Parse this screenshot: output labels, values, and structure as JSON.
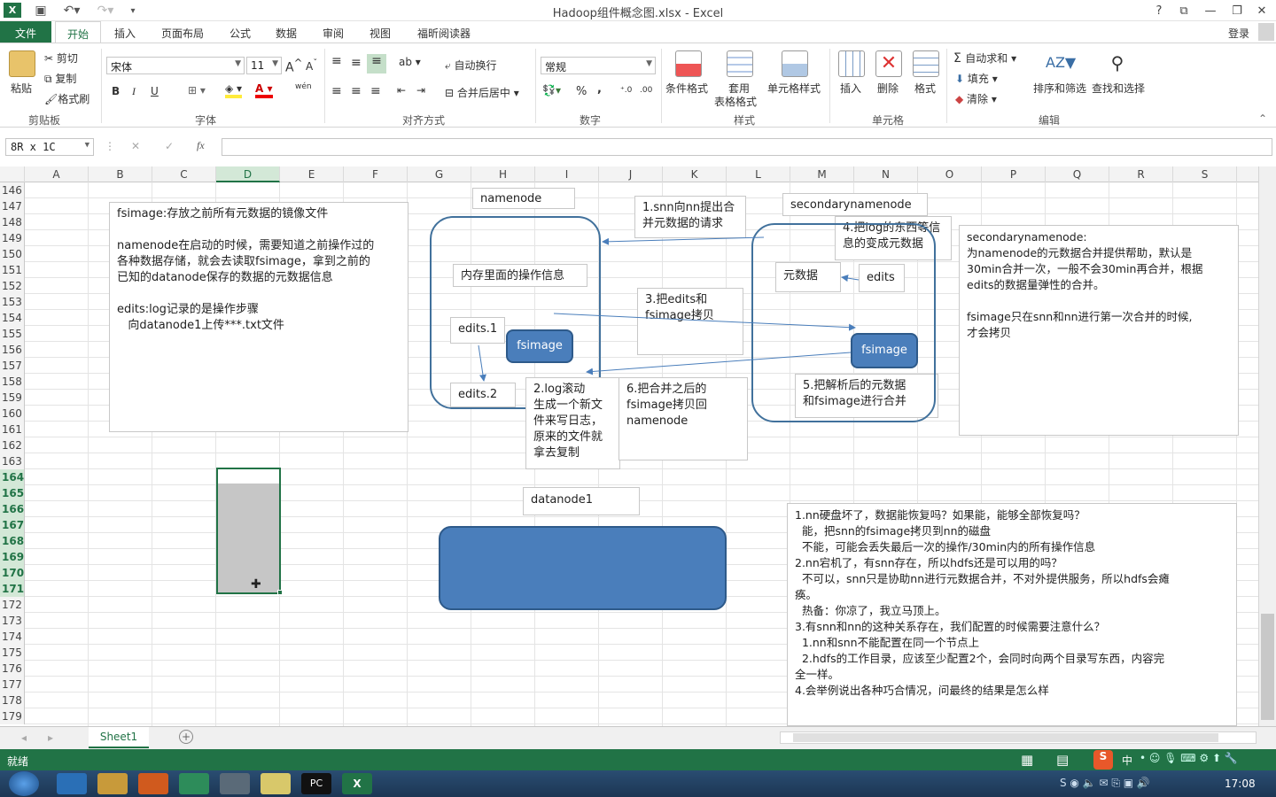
{
  "window": {
    "title": "Hadoop组件概念图.xlsx - Excel",
    "help": "?",
    "signin": "登录"
  },
  "tabs": [
    "文件",
    "开始",
    "插入",
    "页面布局",
    "公式",
    "数据",
    "审阅",
    "视图",
    "福昕阅读器"
  ],
  "ribbon": {
    "clipboard": {
      "paste": "粘贴",
      "cut": "剪切",
      "copy": "复制",
      "painter": "格式刷",
      "label": "剪贴板"
    },
    "font": {
      "name": "宋体",
      "size": "11",
      "bold": "B",
      "italic": "I",
      "underline": "U",
      "label": "字体",
      "wen": "wén"
    },
    "align": {
      "wrap": "自动换行",
      "merge": "合并后居中",
      "label": "对齐方式"
    },
    "number": {
      "format": "常规",
      "label": "数字",
      "percent": "%",
      "comma": ","
    },
    "styles": {
      "cond": "条件格式",
      "table1": "套用",
      "table2": "表格格式",
      "cell": "单元格样式",
      "label": "样式"
    },
    "cells": {
      "insert": "插入",
      "delete": "删除",
      "format": "格式",
      "label": "单元格"
    },
    "edit": {
      "autosum": "自动求和",
      "fill": "填充",
      "clear": "清除",
      "sort": "排序和筛选",
      "find": "查找和选择",
      "label": "编辑"
    }
  },
  "formula_bar": {
    "name_box": "8R x 1C",
    "fx": "fx",
    "cancel": "✕",
    "enter": "✓"
  },
  "columns": [
    "A",
    "B",
    "C",
    "D",
    "E",
    "F",
    "G",
    "H",
    "I",
    "J",
    "K",
    "L",
    "M",
    "N",
    "O",
    "P",
    "Q",
    "R",
    "S"
  ],
  "rows": [
    "146",
    "147",
    "148",
    "149",
    "150",
    "151",
    "152",
    "153",
    "154",
    "155",
    "156",
    "157",
    "158",
    "159",
    "160",
    "161",
    "162",
    "163",
    "164",
    "165",
    "166",
    "167",
    "168",
    "169",
    "170",
    "171",
    "172",
    "173",
    "174",
    "175",
    "176",
    "177",
    "178",
    "179"
  ],
  "diagram": {
    "left_note": [
      "fsimage:存放之前所有元数据的镜像文件",
      "",
      "namenode在启动的时候，需要知道之前操作过的",
      "各种数据存储，就会去读取fsimage，拿到之前的",
      "已知的datanode保存的数据的元数据信息",
      "",
      "edits:log记录的是操作步骤",
      "   向datanode1上传***.txt文件"
    ],
    "namenode": "namenode",
    "memory_ops": "内存里面的操作信息",
    "edits1": "edits.1",
    "edits2": "edits.2",
    "fsimage": "fsimage",
    "step1": [
      "1.snn向nn提出合",
      "并元数据的请求"
    ],
    "step2": [
      "2.log滚动",
      "生成一个新文",
      "件来写日志，",
      "原来的文件就",
      "拿去复制"
    ],
    "step3": [
      "3.把edits和",
      "fsimage拷贝"
    ],
    "step4": [
      "4.把log的东西等信",
      "息的变成元数据"
    ],
    "step5": [
      "5.把解析后的元数据",
      "和fsimage进行合并"
    ],
    "step6": [
      "6.把合并之后的",
      "fsimage拷贝回",
      "namenode"
    ],
    "secondarynamenode": "secondarynamenode",
    "metadata": "元数据",
    "edits": "edits",
    "fsimage2": "fsimage",
    "snn_note": [
      "secondarynamenode:",
      "为namenode的元数据合并提供帮助，默认是",
      "30min合并一次，一般不会30min再合并，根据",
      "edits的数据量弹性的合并。",
      "",
      "fsimage只在snn和nn进行第一次合并的时候,",
      "才会拷贝"
    ],
    "datanode1": "datanode1",
    "qa_note": [
      "1.nn硬盘坏了，数据能恢复吗？如果能，能够全部恢复吗？",
      "  能，把snn的fsimage拷贝到nn的磁盘",
      "  不能，可能会丢失最后一次的操作/30min内的所有操作信息",
      "2.nn宕机了，有snn存在，所以hdfs还是可以用的吗？",
      "  不可以，snn只是协助nn进行元数据合并，不对外提供服务，所以hdfs会瘫",
      "痪。",
      "  热备：你凉了，我立马顶上。",
      "3.有snn和nn的这种关系存在，我们配置的时候需要注意什么？",
      "  1.nn和snn不能配置在同一个节点上",
      "  2.hdfs的工作目录，应该至少配置2个，会同时向两个目录写东西，内容完",
      "全一样。",
      "4.会举例说出各种巧合情况，问最终的结果是怎么样"
    ]
  },
  "sheet": {
    "tab": "Sheet1",
    "add": "+"
  },
  "status": {
    "ready": "就绪",
    "ime": "中"
  },
  "taskbar": {
    "time": "17:08"
  }
}
